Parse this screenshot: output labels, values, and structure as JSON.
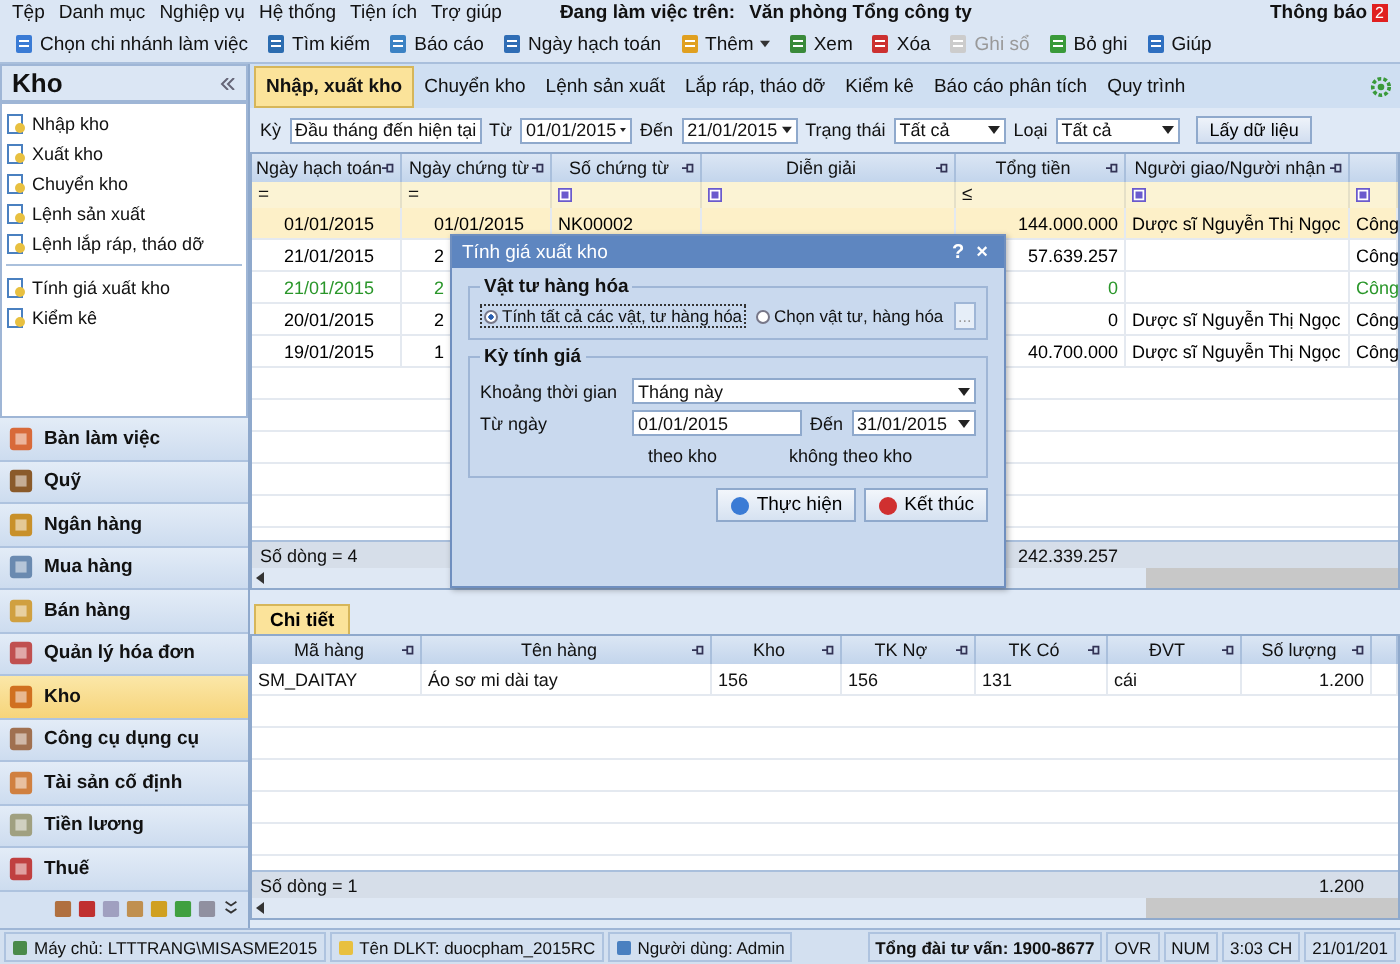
{
  "menu": [
    "Tệp",
    "Danh mục",
    "Nghiệp vụ",
    "Hệ thống",
    "Tiện ích",
    "Trợ giúp"
  ],
  "working_on": {
    "label": "Đang làm việc trên:",
    "value": "Văn phòng Tổng công ty"
  },
  "notifications": {
    "label": "Thông báo",
    "count": "2"
  },
  "toolbar": [
    {
      "label": "Chọn chi nhánh làm việc",
      "disabled": false,
      "kind": "button"
    },
    {
      "label": "Tìm kiếm",
      "disabled": false,
      "kind": "button"
    },
    {
      "label": "Báo cáo",
      "disabled": false,
      "kind": "button"
    },
    {
      "label": "Ngày hạch toán",
      "disabled": false,
      "kind": "button"
    },
    {
      "label": "Thêm",
      "disabled": false,
      "kind": "dropdown"
    },
    {
      "label": "Xem",
      "disabled": false,
      "kind": "button"
    },
    {
      "label": "Xóa",
      "disabled": false,
      "kind": "button"
    },
    {
      "label": "Ghi sổ",
      "disabled": true,
      "kind": "button"
    },
    {
      "label": "Bỏ ghi",
      "disabled": false,
      "kind": "button"
    },
    {
      "label": "Giúp",
      "disabled": false,
      "kind": "button"
    }
  ],
  "sidebar": {
    "title": "Kho",
    "groups": [
      [
        "Nhập kho",
        "Xuất kho",
        "Chuyển kho",
        "Lệnh sản xuất",
        "Lệnh lắp ráp, tháo dỡ"
      ],
      [
        "Tính giá xuất kho",
        "Kiểm kê"
      ]
    ],
    "modules": [
      {
        "label": "Bàn làm việc",
        "selected": false
      },
      {
        "label": "Quỹ",
        "selected": false
      },
      {
        "label": "Ngân hàng",
        "selected": false
      },
      {
        "label": "Mua hàng",
        "selected": false
      },
      {
        "label": "Bán hàng",
        "selected": false
      },
      {
        "label": "Quản lý hóa đơn",
        "selected": false
      },
      {
        "label": "Kho",
        "selected": true
      },
      {
        "label": "Công cụ dụng cụ",
        "selected": false
      },
      {
        "label": "Tài sản cố định",
        "selected": false
      },
      {
        "label": "Tiền lương",
        "selected": false
      },
      {
        "label": "Thuế",
        "selected": false
      }
    ]
  },
  "tabs": [
    {
      "label": "Nhập, xuất kho",
      "selected": true
    },
    {
      "label": "Chuyển kho",
      "selected": false
    },
    {
      "label": "Lệnh sản xuất",
      "selected": false
    },
    {
      "label": "Lắp ráp, tháo dỡ",
      "selected": false
    },
    {
      "label": "Kiểm kê",
      "selected": false
    },
    {
      "label": "Báo cáo phân tích",
      "selected": false
    },
    {
      "label": "Quy trình",
      "selected": false
    }
  ],
  "filters": [
    {
      "label": "Kỳ",
      "value": "Đầu tháng đến hiện tại"
    },
    {
      "label": "Từ",
      "value": "01/01/2015"
    },
    {
      "label": "Đến",
      "value": "21/01/2015"
    },
    {
      "label": "Trạng thái",
      "value": "Tất cả"
    },
    {
      "label": "Loại",
      "value": "Tất cả"
    }
  ],
  "fetch_button": "Lấy dữ liệu",
  "table": {
    "columns": [
      "Ngày hạch toán",
      "Ngày chứng từ",
      "Số chứng từ",
      "Diễn giải",
      "Tổng tiền",
      "Người giao/Người nhận"
    ],
    "filter_ops": [
      {
        "kind": "operator",
        "text": "="
      },
      {
        "kind": "operator",
        "text": "="
      },
      {
        "kind": "box"
      },
      {
        "kind": "box"
      },
      {
        "kind": "operator",
        "text": "≤"
      },
      {
        "kind": "box"
      },
      {
        "kind": "box"
      }
    ],
    "rows": [
      {
        "cells": [
          "01/01/2015",
          "01/01/2015",
          "NK00002",
          null,
          "144.000.000",
          "Dược sĩ Nguyễn Thị Ngọc",
          "Công"
        ],
        "selected": true,
        "color": "#000000"
      },
      {
        "cells": [
          "21/01/2015",
          "2",
          null,
          null,
          "57.639.257",
          null,
          "Công"
        ],
        "selected": false,
        "color": "#000000"
      },
      {
        "cells": [
          "21/01/2015",
          "2",
          null,
          null,
          "0",
          null,
          "Công"
        ],
        "selected": false,
        "color": "#2a962a"
      },
      {
        "cells": [
          "20/01/2015",
          "2",
          null,
          null,
          "0",
          "Dược sĩ Nguyễn Thị Ngọc",
          "Công"
        ],
        "selected": false,
        "color": "#000000"
      },
      {
        "cells": [
          "19/01/2015",
          "1",
          null,
          null,
          "40.700.000",
          "Dược sĩ Nguyễn Thị Ngọc",
          "Công"
        ],
        "selected": false,
        "color": "#000000"
      }
    ],
    "row_count": "Số dòng = 4",
    "total": "242.339.257"
  },
  "dialog": {
    "title": "Tính giá xuất kho",
    "help": "?",
    "close": "×",
    "goods_group": {
      "title": "Vật tư hàng hóa",
      "options": [
        {
          "label": "Tính tất cả các vật, tư hàng hóa",
          "selected": true
        },
        {
          "label": "Chọn vật tư, hàng hóa",
          "selected": false
        }
      ],
      "pick_button": "..."
    },
    "period_group": {
      "title": "Kỳ tính giá",
      "period_label": "Khoảng thời gian",
      "period_value": "Tháng này",
      "from_label": "Từ ngày",
      "from_value": "01/01/2015",
      "to_label": "Đến",
      "to_value": "31/01/2015",
      "methods": [
        "theo kho",
        "không theo kho"
      ]
    },
    "buttons": [
      {
        "label": "Thực hiện",
        "kind": "run"
      },
      {
        "label": "Kết thúc",
        "kind": "close"
      }
    ]
  },
  "detail": {
    "tab": "Chi tiết",
    "columns": [
      "Mã hàng",
      "Tên hàng",
      "Kho",
      "TK Nợ",
      "TK Có",
      "ĐVT",
      "Số lượng"
    ],
    "rows": [
      [
        "SM_DAITAY",
        "Áo sơ mi dài tay",
        "156",
        "156",
        "131",
        "cái",
        "1.200"
      ]
    ],
    "row_count": "Số dòng = 1",
    "total": "1.200"
  },
  "status_bar": [
    {
      "text": "Máy chủ: LTTTRANG\\MISASME2015",
      "kind": "server"
    },
    {
      "text": "Tên DLKT: duocpham_2015RC",
      "kind": "db"
    },
    {
      "text": "Người dùng: Admin",
      "kind": "user"
    },
    {
      "text": "Tổng đài tư vấn: 1900-8677",
      "kind": "hotline"
    },
    {
      "text": "OVR",
      "kind": "plain"
    },
    {
      "text": "NUM",
      "kind": "plain"
    },
    {
      "text": "3:03 CH",
      "kind": "plain"
    },
    {
      "text": "21/01/201",
      "kind": "plain"
    }
  ]
}
